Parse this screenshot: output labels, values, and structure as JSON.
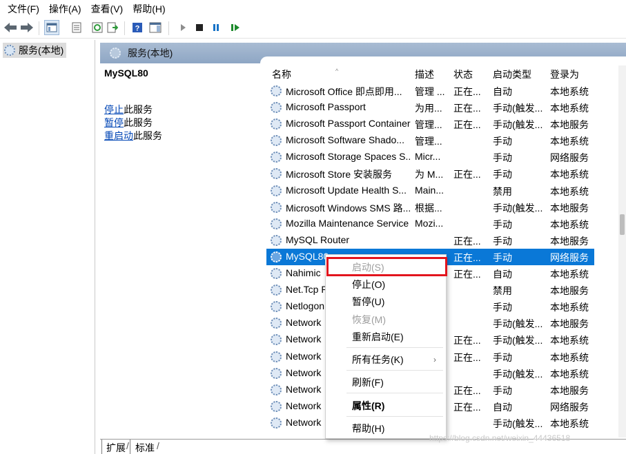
{
  "menubar": [
    "文件(F)",
    "操作(A)",
    "查看(V)",
    "帮助(H)"
  ],
  "toolbar_icons": [
    "back-arrow-icon",
    "forward-arrow-icon",
    "show-hide-console-tree-icon",
    "properties-icon",
    "refresh-icon",
    "export-list-icon",
    "help-icon",
    "show-action-pane-icon",
    "start-service-icon",
    "stop-service-icon",
    "pause-service-icon",
    "restart-service-icon"
  ],
  "tree": {
    "root_label": "服务(本地)"
  },
  "pane": {
    "header": "服务(本地)",
    "selected_name": "MySQL80",
    "action_stop": "停止",
    "action_stop_suffix": "此服务",
    "action_pause": "暂停",
    "action_pause_suffix": "此服务",
    "action_restart": "重启动",
    "action_restart_suffix": "此服务"
  },
  "columns": [
    "名称",
    "描述",
    "状态",
    "启动类型",
    "登录为"
  ],
  "rows": [
    {
      "name": "Microsoft Office 即点即用...",
      "desc": "管理 ...",
      "status": "正在...",
      "type": "自动",
      "logon": "本地系统"
    },
    {
      "name": "Microsoft Passport",
      "desc": "为用...",
      "status": "正在...",
      "type": "手动(触发...",
      "logon": "本地系统"
    },
    {
      "name": "Microsoft Passport Container",
      "desc": "管理...",
      "status": "正在...",
      "type": "手动(触发...",
      "logon": "本地服务"
    },
    {
      "name": "Microsoft Software Shado...",
      "desc": "管理...",
      "status": "",
      "type": "手动",
      "logon": "本地系统"
    },
    {
      "name": "Microsoft Storage Spaces S...",
      "desc": "Micr...",
      "status": "",
      "type": "手动",
      "logon": "网络服务"
    },
    {
      "name": "Microsoft Store 安装服务",
      "desc": "为 M...",
      "status": "正在...",
      "type": "手动",
      "logon": "本地系统"
    },
    {
      "name": "Microsoft Update Health S...",
      "desc": "Main...",
      "status": "",
      "type": "禁用",
      "logon": "本地系统"
    },
    {
      "name": "Microsoft Windows SMS 路...",
      "desc": "根据...",
      "status": "",
      "type": "手动(触发...",
      "logon": "本地服务"
    },
    {
      "name": "Mozilla Maintenance Service",
      "desc": "Mozi...",
      "status": "",
      "type": "手动",
      "logon": "本地系统"
    },
    {
      "name": "MySQL Router",
      "desc": "",
      "status": "正在...",
      "type": "手动",
      "logon": "本地服务"
    },
    {
      "name": "MySQL80",
      "desc": "",
      "status": "正在...",
      "type": "手动",
      "logon": "网络服务"
    },
    {
      "name": "Nahimic",
      "desc": "",
      "status": "正在...",
      "type": "自动",
      "logon": "本地系统"
    },
    {
      "name": "Net.Tcp P",
      "desc": "",
      "status": "",
      "type": "禁用",
      "logon": "本地服务"
    },
    {
      "name": "Netlogon",
      "desc": "",
      "status": "",
      "type": "手动",
      "logon": "本地系统"
    },
    {
      "name": "Network",
      "desc": "",
      "status": "",
      "type": "手动(触发...",
      "logon": "本地服务"
    },
    {
      "name": "Network",
      "desc": "",
      "status": "正在...",
      "type": "手动(触发...",
      "logon": "本地系统"
    },
    {
      "name": "Network",
      "desc": "",
      "status": "正在...",
      "type": "手动",
      "logon": "本地系统"
    },
    {
      "name": "Network",
      "desc": "",
      "status": "",
      "type": "手动(触发...",
      "logon": "本地系统"
    },
    {
      "name": "Network",
      "desc": "",
      "status": "正在...",
      "type": "手动",
      "logon": "本地服务"
    },
    {
      "name": "Network",
      "desc": "",
      "status": "正在...",
      "type": "自动",
      "logon": "网络服务"
    },
    {
      "name": "Network",
      "desc": "",
      "status": "",
      "type": "手动(触发...",
      "logon": "本地系统"
    }
  ],
  "context_menu": {
    "start": "启动(S)",
    "stop": "停止(O)",
    "pause": "暂停(U)",
    "resume": "恢复(M)",
    "restart": "重新启动(E)",
    "all_tasks": "所有任务(K)",
    "refresh": "刷新(F)",
    "properties": "属性(R)",
    "help": "帮助(H)"
  },
  "tabs": [
    "扩展",
    "标准"
  ],
  "watermark": "https://blog.csdn.net/weixin_44436518"
}
